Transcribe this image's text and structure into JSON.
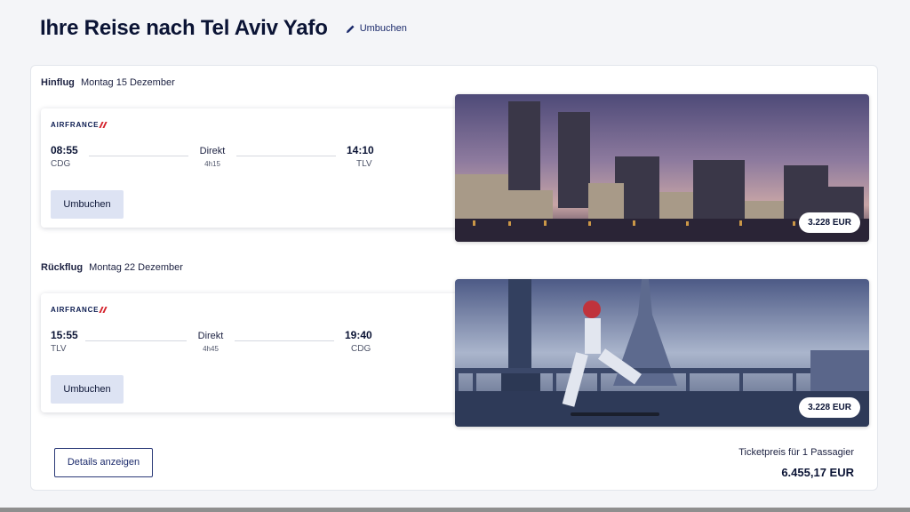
{
  "header": {
    "title": "Ihre Reise nach Tel Aviv Yafo",
    "edit_label": "Umbuchen"
  },
  "outbound": {
    "label": "Hinflug",
    "date": "Montag 15 Dezember",
    "airline": "AIRFRANCE",
    "departure_time": "08:55",
    "departure_code": "CDG",
    "arrival_time": "14:10",
    "arrival_code": "TLV",
    "stops": "Direkt",
    "duration": "4h15",
    "rebook_label": "Umbuchen",
    "price": "3.228 EUR"
  },
  "return": {
    "label": "Rückflug",
    "date": "Montag 22 Dezember",
    "airline": "AIRFRANCE",
    "departure_time": "15:55",
    "departure_code": "TLV",
    "arrival_time": "19:40",
    "arrival_code": "CDG",
    "stops": "Direkt",
    "duration": "4h45",
    "rebook_label": "Umbuchen",
    "price": "3.228 EUR"
  },
  "footer": {
    "details_label": "Details anzeigen",
    "ticket_label": "Ticketpreis für 1 Passagier",
    "total": "6.455,17 EUR"
  },
  "icons": {
    "edit": "pencil-icon"
  },
  "colors": {
    "brand_navy": "#0b1435",
    "button_bg": "#dde3f3",
    "airline_red": "#d4202a"
  }
}
